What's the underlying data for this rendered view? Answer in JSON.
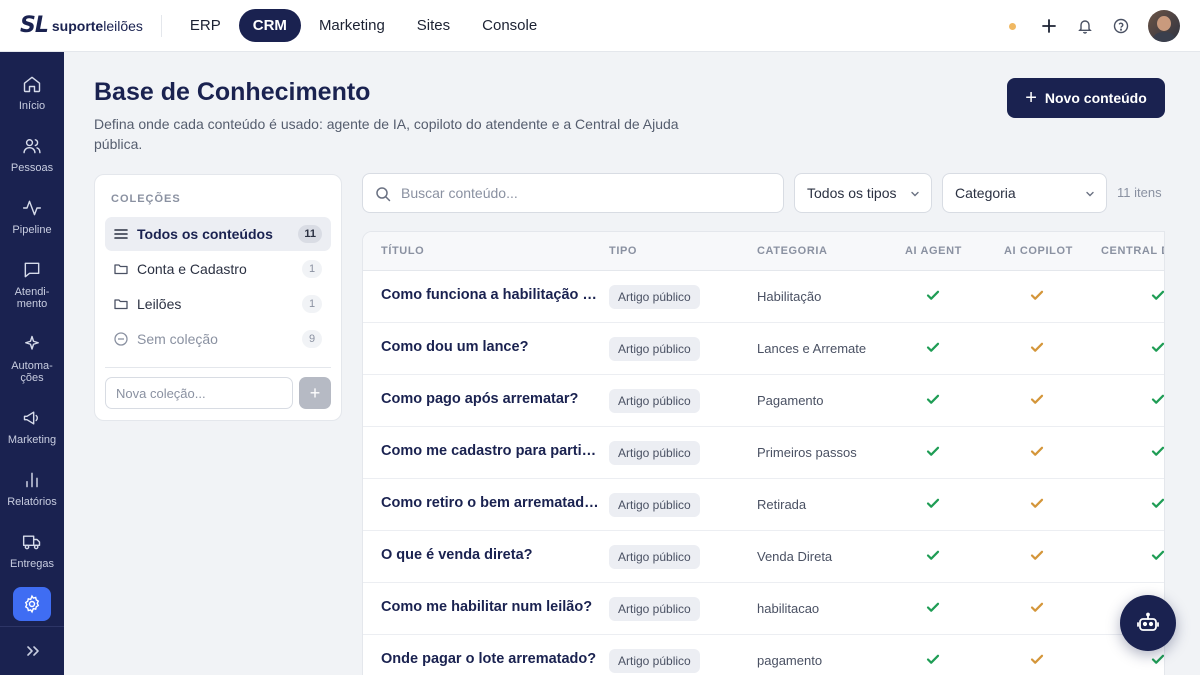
{
  "brand": {
    "mark": "SL",
    "name_bold": "suporte",
    "name_light": "leilões"
  },
  "nav": {
    "items": [
      {
        "label": "ERP",
        "active": false
      },
      {
        "label": "CRM",
        "active": true
      },
      {
        "label": "Marketing",
        "active": false
      },
      {
        "label": "Sites",
        "active": false
      },
      {
        "label": "Console",
        "active": false
      }
    ]
  },
  "colors": {
    "primary": "#1a2250",
    "accent_blue": "#3f6df3",
    "check_green": "#1f9d55",
    "check_amber": "#d4963a",
    "status_dot": "#f0b862"
  },
  "sidebar": {
    "items": [
      {
        "label": "Início",
        "icon": "home-icon"
      },
      {
        "label": "Pessoas",
        "icon": "users-icon"
      },
      {
        "label": "Pipeline",
        "icon": "activity-icon"
      },
      {
        "label": "Atendi-\nmento",
        "icon": "chat-icon"
      },
      {
        "label": "Automa-\nções",
        "icon": "sparkle-icon"
      },
      {
        "label": "Marketing",
        "icon": "megaphone-icon"
      },
      {
        "label": "Relatórios",
        "icon": "bar-chart-icon"
      },
      {
        "label": "Entregas",
        "icon": "truck-icon"
      }
    ]
  },
  "page": {
    "title": "Base de Conhecimento",
    "subtitle": "Defina onde cada conteúdo é usado: agente de IA, copiloto do atendente e a Central de Ajuda pública.",
    "new_button": "Novo conteúdo"
  },
  "collections": {
    "heading": "COLEÇÕES",
    "items": [
      {
        "label": "Todos os conteúdos",
        "count": "11",
        "active": true,
        "icon": "list-icon"
      },
      {
        "label": "Conta e Cadastro",
        "count": "1",
        "active": false,
        "icon": "folder-icon"
      },
      {
        "label": "Leilões",
        "count": "1",
        "active": false,
        "icon": "folder-icon"
      },
      {
        "label": "Sem coleção",
        "count": "9",
        "active": false,
        "icon": "minus-circle-icon"
      }
    ],
    "new_placeholder": "Nova coleção...",
    "add_label": "+"
  },
  "filters": {
    "search_placeholder": "Buscar conteúdo...",
    "type_select": "Todos os tipos",
    "category_select": "Categoria",
    "count_label": "11 itens"
  },
  "table": {
    "headers": {
      "title": "TÍTULO",
      "type": "TIPO",
      "category": "CATEGORIA",
      "ai_agent": "AI AGENT",
      "ai_copilot": "AI COPILOT",
      "central": "CENTRAL DE AJUDA"
    },
    "rows": [
      {
        "title": "Como funciona a habilitação em leilões?",
        "type": "Artigo público",
        "category": "Habilitação",
        "ai_agent": true,
        "ai_copilot": true,
        "central": true
      },
      {
        "title": "Como dou um lance?",
        "type": "Artigo público",
        "category": "Lances e Arremate",
        "ai_agent": true,
        "ai_copilot": true,
        "central": true
      },
      {
        "title": "Como pago após arrematar?",
        "type": "Artigo público",
        "category": "Pagamento",
        "ai_agent": true,
        "ai_copilot": true,
        "central": true
      },
      {
        "title": "Como me cadastro para participar?",
        "type": "Artigo público",
        "category": "Primeiros passos",
        "ai_agent": true,
        "ai_copilot": true,
        "central": true
      },
      {
        "title": "Como retiro o bem arrematado?",
        "type": "Artigo público",
        "category": "Retirada",
        "ai_agent": true,
        "ai_copilot": true,
        "central": true
      },
      {
        "title": "O que é venda direta?",
        "type": "Artigo público",
        "category": "Venda Direta",
        "ai_agent": true,
        "ai_copilot": true,
        "central": true
      },
      {
        "title": "Como me habilitar num leilão?",
        "type": "Artigo público",
        "category": "habilitacao",
        "ai_agent": true,
        "ai_copilot": true,
        "central": true
      },
      {
        "title": "Onde pagar o lote arrematado?",
        "type": "Artigo público",
        "category": "pagamento",
        "ai_agent": true,
        "ai_copilot": true,
        "central": true
      }
    ]
  }
}
